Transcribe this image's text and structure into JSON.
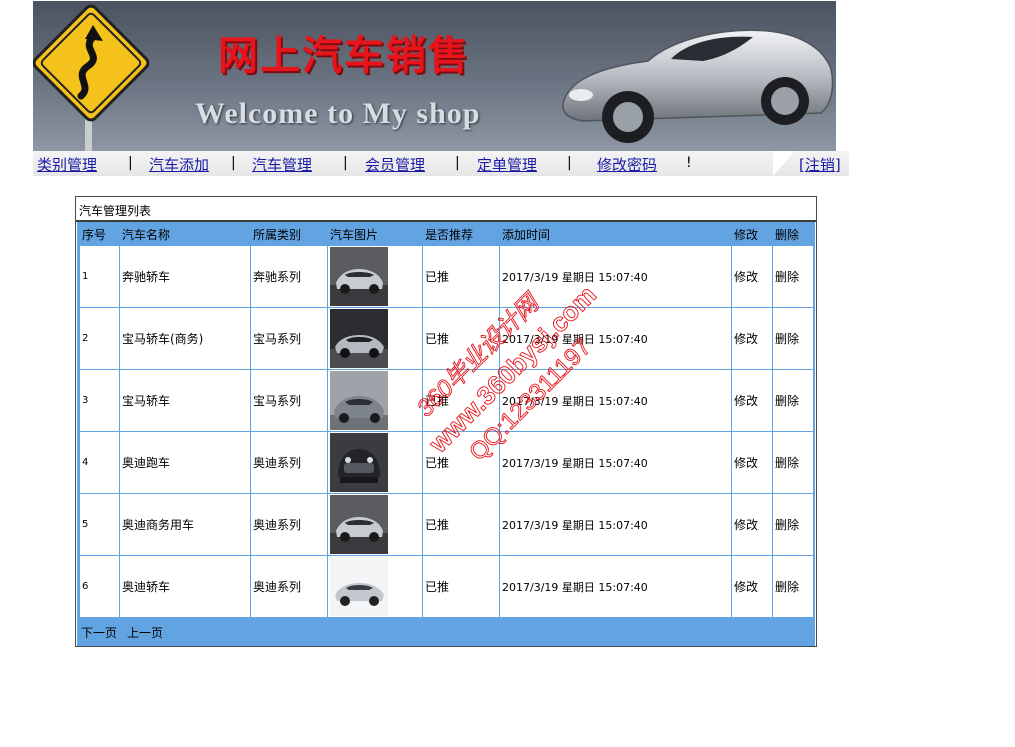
{
  "banner": {
    "cn_title": "网上汽车销售",
    "en_title": "Welcome to My shop"
  },
  "nav": {
    "items": [
      "类别管理",
      "汽车添加",
      "汽车管理",
      "会员管理",
      "定单管理",
      "修改密码"
    ],
    "separator": "|",
    "trailing_mark": "!",
    "logout": "[注销]"
  },
  "panel": {
    "caption": "汽车管理列表",
    "columns": [
      "序号",
      "汽车名称",
      "所属类别",
      "汽车图片",
      "是否推荐",
      "添加时间",
      "修改",
      "删除"
    ],
    "rows": [
      {
        "id": "1",
        "name": "奔驰轿车",
        "category": "奔驰系列",
        "recommended": "已推",
        "added": "2017/3/19 星期日 15:07:40",
        "edit": "修改",
        "delete": "删除"
      },
      {
        "id": "2",
        "name": "宝马轿车(商务)",
        "category": "宝马系列",
        "recommended": "已推",
        "added": "2017/3/19 星期日 15:07:40",
        "edit": "修改",
        "delete": "删除"
      },
      {
        "id": "3",
        "name": "宝马轿车",
        "category": "宝马系列",
        "recommended": "已推",
        "added": "2017/3/19 星期日 15:07:40",
        "edit": "修改",
        "delete": "删除"
      },
      {
        "id": "4",
        "name": "奥迪跑车",
        "category": "奥迪系列",
        "recommended": "已推",
        "added": "2017/3/19 星期日 15:07:40",
        "edit": "修改",
        "delete": "删除"
      },
      {
        "id": "5",
        "name": "奥迪商务用车",
        "category": "奥迪系列",
        "recommended": "已推",
        "added": "2017/3/19 星期日 15:07:40",
        "edit": "修改",
        "delete": "删除"
      },
      {
        "id": "6",
        "name": "奥迪轿车",
        "category": "奥迪系列",
        "recommended": "已推",
        "added": "2017/3/19 星期日 15:07:40",
        "edit": "修改",
        "delete": "删除"
      }
    ],
    "pager": {
      "next": "下一页",
      "prev": "上一页"
    }
  },
  "watermark": {
    "line1": "360毕业设计网",
    "line2": "www.360bysj.com",
    "line3": "QQ:123311197"
  },
  "colors": {
    "table_header": "#62a4e2",
    "nav_link": "#1a1aa6",
    "banner_title": "#e8141c",
    "watermark": "#e8141c"
  }
}
